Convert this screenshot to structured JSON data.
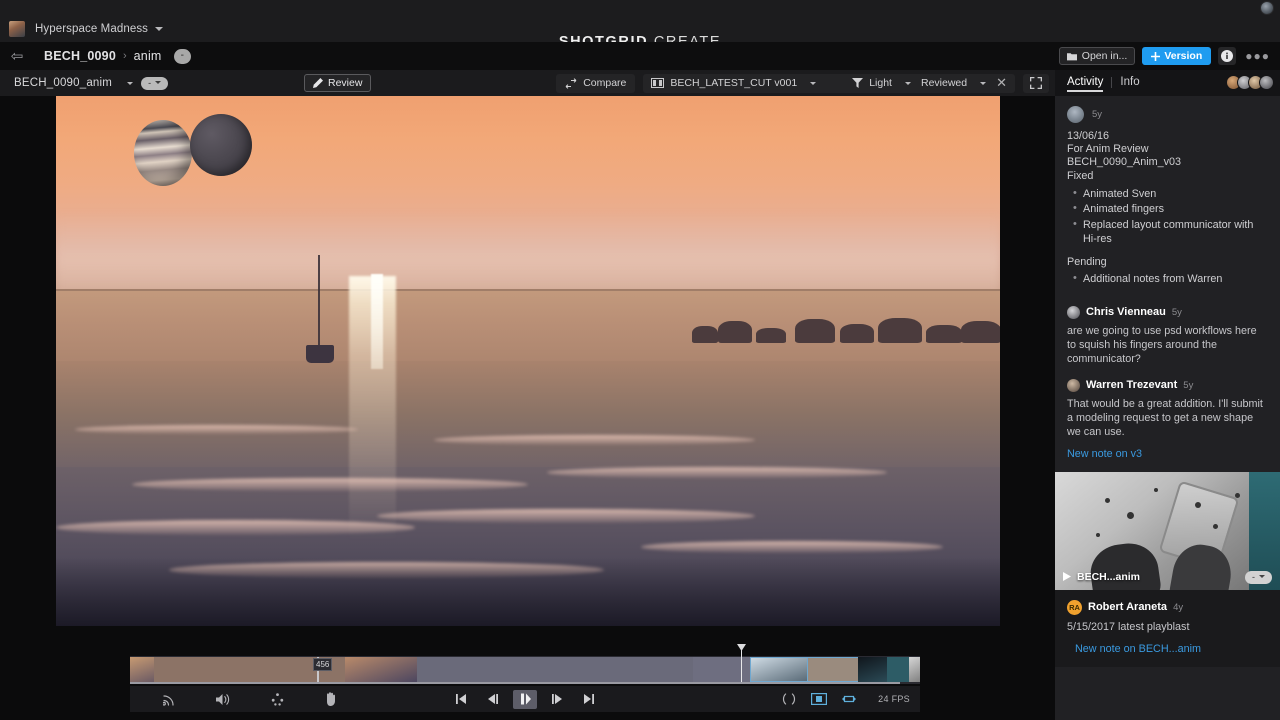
{
  "app": {
    "title_bold": "SHOTGRID",
    "title_light": "CREATE"
  },
  "project_bar": {
    "project_name": "Hyperspace Madness",
    "chevron_icon": "chevron-down-icon",
    "account_icon": "user-avatar-icon"
  },
  "breadcrumb": {
    "back_icon": "back-arrow-icon",
    "shot": "BECH_0090",
    "separator": "›",
    "step": "anim",
    "status": "-",
    "open_in_label": "Open in...",
    "open_in_icon": "folder-icon",
    "version_label": "Version",
    "version_icon": "plus-icon",
    "info_icon": "info-icon",
    "more_icon": "more-options-icon"
  },
  "viewer_toolbar": {
    "version_name": "BECH_0090_anim",
    "version_chevron": "chevron-down-icon",
    "status_pill": "-",
    "review_label": "Review",
    "review_icon": "pencil-icon",
    "compare_label": "Compare",
    "compare_icon": "compare-icon",
    "cut_name": "BECH_LATEST_CUT v001",
    "cut_icon": "filmstrip-icon",
    "filter_icon": "filter-icon",
    "filter_label": "Light",
    "status_filter_label": "Reviewed",
    "close_icon": "close-icon",
    "fullscreen_icon": "fullscreen-icon"
  },
  "viewer": {
    "media_description": "Sunset seascape with two moons over an alien ocean, small boat and rocky shoreline"
  },
  "playback": {
    "current_frame_label": "456",
    "fps_label": "24 FPS",
    "icons": {
      "broadcast": "cast-icon",
      "volume": "volume-icon",
      "quality": "quality-icon",
      "pan": "hand-tool-icon",
      "first_frame": "skip-to-start-icon",
      "prev_frame": "step-back-icon",
      "play_pause": "pause-icon",
      "next_frame": "step-forward-icon",
      "last_frame": "skip-to-end-icon",
      "in_out": "in-out-range-icon",
      "fit": "fit-frame-icon",
      "loop": "loop-icon"
    }
  },
  "right_panel": {
    "tabs": [
      {
        "label": "Activity",
        "active": true
      },
      {
        "label": "Info",
        "active": false
      }
    ],
    "note": {
      "author_avatar": "user-avatar-icon",
      "age": "5y",
      "date": "13/06/16",
      "subject": "For Anim Review",
      "version": "BECH_0090_Anim_v03",
      "fixed_label": "Fixed",
      "fixed_items": [
        "Animated Sven",
        "Animated fingers",
        "Replaced layout communicator with Hi-res"
      ],
      "pending_label": "Pending",
      "pending_items": [
        "Additional notes from Warren"
      ]
    },
    "comments": [
      {
        "name": "Chris Vienneau",
        "age": "5y",
        "text": "are we going to use psd workflows here to squish his fingers around the communicator?"
      },
      {
        "name": "Warren Trezevant",
        "age": "5y",
        "text": "That would be a great addition. I'll submit a modeling request to get a new shape we can use."
      }
    ],
    "reply_link": "New note on v3",
    "media_card": {
      "label": "BECH...anim",
      "play_icon": "play-icon",
      "status_pill": "-",
      "author_initials": "RA",
      "author_name": "Robert Araneta",
      "age": "4y",
      "text": "5/15/2017 latest playblast",
      "link": "New note on BECH...anim"
    }
  },
  "colors": {
    "accent_blue": "#1f9cf0",
    "link_blue": "#3a9ae0",
    "panel_bg": "#212124",
    "app_bg": "#101011"
  }
}
